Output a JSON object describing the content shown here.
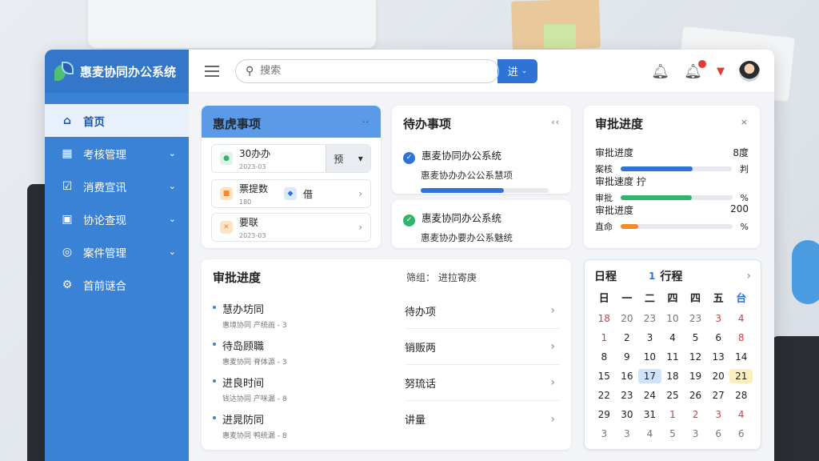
{
  "app": {
    "title": "惠麦协同办公系统"
  },
  "sidebar": {
    "items": [
      {
        "label": "首页",
        "icon": "home-icon"
      },
      {
        "label": "考核管理",
        "icon": "grid-icon"
      },
      {
        "label": "消费宣讯",
        "icon": "edit-icon"
      },
      {
        "label": "协论查现",
        "icon": "chart-icon"
      },
      {
        "label": "案件管理",
        "icon": "circle-icon"
      },
      {
        "label": "首前谜合",
        "icon": "gear-icon"
      }
    ]
  },
  "search": {
    "placeholder": "搜索",
    "button_label": "进"
  },
  "colors": {
    "primary": "#3a82d6",
    "sidebar": "#3a82d6",
    "green": "#34b36a",
    "orange": "#f28c28",
    "red": "#e23b3b"
  },
  "card_pending": {
    "title": "惠虎事项",
    "more": "··",
    "rows": [
      {
        "title": "30办办",
        "sub": "2023-03",
        "select": "预"
      },
      {
        "title": "票提数",
        "sub": "180",
        "extra": "借"
      },
      {
        "title": "要联",
        "sub": "2023-03"
      }
    ]
  },
  "card_todo": {
    "title": "待办事项",
    "more": "‹‹",
    "items": [
      {
        "title": "惠麦协同办公系统",
        "sub": "惠麦协办办公公系慧项",
        "progress": 0.65
      },
      {
        "title": "惠麦协同办公系统",
        "sub": "惠麦协办要办公系魅统"
      }
    ]
  },
  "card_approval_small": {
    "title": "审批进度",
    "more": "×",
    "rows": [
      {
        "label": "审批进度",
        "value": "8度",
        "sub": "案核",
        "tail": "判",
        "progress": 0.65,
        "color": "#2f73d6"
      },
      {
        "label": "审批速度 拧",
        "value": "",
        "sub": "审批",
        "tail": "%",
        "progress": 0.64,
        "color": "#34b36a"
      },
      {
        "label": "审批进度",
        "value": "200",
        "sub": "直命",
        "tail": "%",
        "progress": 0.16,
        "color": "#f28c28"
      }
    ]
  },
  "card_approval_big": {
    "title": "审批进度",
    "filter": "筛组： 进拉寄庚",
    "left_items": [
      {
        "title": "慧办坊同",
        "sub": "惠境协同 产统画 - 3"
      },
      {
        "title": "待岛顾職",
        "sub": "惠麦协同 脊体源 - 3"
      },
      {
        "title": "进良时间",
        "sub": "钱达协同 产咪漏 - 8"
      },
      {
        "title": "进晁防同",
        "sub": "惠麦协同 鸭统漏 - 8"
      }
    ],
    "right_items": [
      "待办项",
      "销贩两",
      "努琉话",
      "讲量"
    ]
  },
  "calendar": {
    "title": "日程",
    "number": "1",
    "subtitle": "行程",
    "weekdays": [
      "日",
      "一",
      "二",
      "四",
      "四",
      "五",
      "台"
    ],
    "rows": [
      [
        "18",
        "20",
        "23",
        "10",
        "23",
        "3",
        "4"
      ],
      [
        "1",
        "2",
        "3",
        "4",
        "5",
        "6",
        "8"
      ],
      [
        "8",
        "9",
        "10",
        "11",
        "12",
        "13",
        "14"
      ],
      [
        "15",
        "16",
        "17",
        "18",
        "19",
        "20",
        "21"
      ],
      [
        "22",
        "23",
        "24",
        "25",
        "26",
        "27",
        "28"
      ],
      [
        "29",
        "30",
        "31",
        "1",
        "2",
        "3",
        "4"
      ],
      [
        "3",
        "3",
        "4",
        "5",
        "3",
        "6",
        "6"
      ]
    ]
  }
}
